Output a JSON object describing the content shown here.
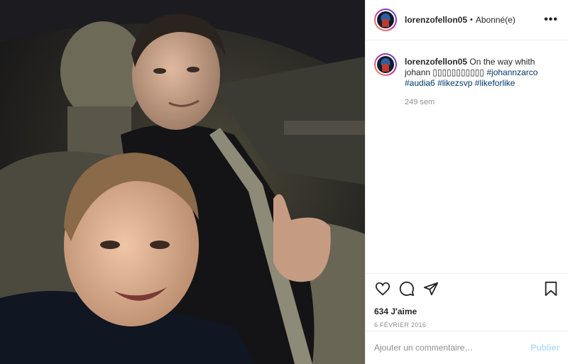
{
  "post": {
    "username": "lorenzofellon05",
    "separator": "•",
    "follow_status": "Abonné(e)",
    "more_icon": "more-options-icon"
  },
  "caption": {
    "username": "lorenzofellon05",
    "text": "On the way whith johann ",
    "emoji_run": "▯▯▯▯▯▯▯▯▯▯▯",
    "hashtags": [
      "#johannzarco",
      "#audia6",
      "#likezsvp",
      "#likeforlike"
    ],
    "time": "249 sem"
  },
  "actions": {
    "like_icon": "heart-icon",
    "comment_icon": "comment-icon",
    "share_icon": "share-icon",
    "save_icon": "bookmark-icon"
  },
  "stats": {
    "likes": "634 J'aime",
    "date": "6 FÉVRIER 2016"
  },
  "comment_box": {
    "placeholder": "Ajouter un commentaire…",
    "publish_label": "Publier"
  },
  "colors": {
    "hashtag": "#00376b",
    "muted": "#8e8e8e",
    "publish_disabled": "#b2dffc"
  }
}
